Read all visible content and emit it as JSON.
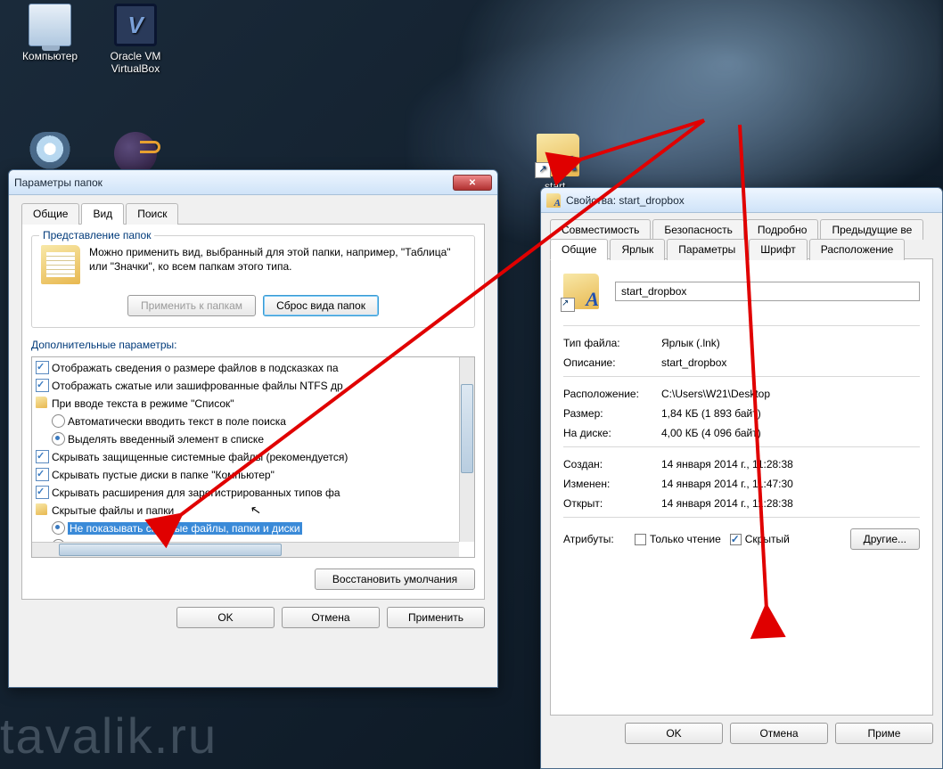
{
  "watermark": "tavalik.ru",
  "desktop": {
    "computer": "Компьютер",
    "vbox": "Oracle VM VirtualBox",
    "shortcut": "start_"
  },
  "folderOptions": {
    "title": "Параметры папок",
    "tabs": {
      "general": "Общие",
      "view": "Вид",
      "search": "Поиск"
    },
    "group_legend": "Представление папок",
    "group_text": "Можно применить вид, выбранный для этой папки, например, \"Таблица\" или \"Значки\", ко всем папкам этого типа.",
    "apply_folders": "Применить к папкам",
    "reset_folders": "Сброс вида папок",
    "adv_label": "Дополнительные параметры:",
    "items": {
      "i1": "Отображать сведения о размере файлов в подсказках па",
      "i2": "Отображать сжатые или зашифрованные файлы NTFS др",
      "i3": "При вводе текста в режиме \"Список\"",
      "i3a": "Автоматически вводить текст в поле поиска",
      "i3b": "Выделять введенный элемент в списке",
      "i4": "Скрывать защищенные системные файлы (рекомендуется)",
      "i5": "Скрывать пустые диски в папке \"Компьютер\"",
      "i6": "Скрывать расширения для зарегистрированных типов фа",
      "i7": "Скрытые файлы и папки",
      "i7a": "Не показывать скрытые файлы, папки и диски",
      "i7b": "Показывать скрытые файлы, папки и диски"
    },
    "restore": "Восстановить умолчания",
    "ok": "OK",
    "cancel": "Отмена",
    "apply": "Применить"
  },
  "props": {
    "title": "Свойства: start_dropbox",
    "tabs": {
      "compat": "Совместимость",
      "security": "Безопасность",
      "details": "Подробно",
      "prev": "Предыдущие ве",
      "general": "Общие",
      "shortcut": "Ярлык",
      "options": "Параметры",
      "font": "Шрифт",
      "layout": "Расположение"
    },
    "name_value": "start_dropbox",
    "type_k": "Тип файла:",
    "type_v": "Ярлык (.lnk)",
    "desc_k": "Описание:",
    "desc_v": "start_dropbox",
    "loc_k": "Расположение:",
    "loc_v": "C:\\Users\\W21\\Desktop",
    "size_k": "Размер:",
    "size_v": "1,84 КБ (1 893 байт)",
    "ondisk_k": "На диске:",
    "ondisk_v": "4,00 КБ (4 096 байт)",
    "created_k": "Создан:",
    "created_v": "14 января 2014 г., 11:28:38",
    "modified_k": "Изменен:",
    "modified_v": "14 января 2014 г., 11:47:30",
    "accessed_k": "Открыт:",
    "accessed_v": "14 января 2014 г., 11:28:38",
    "attr_k": "Атрибуты:",
    "readonly": "Только чтение",
    "hidden": "Скрытый",
    "other": "Другие...",
    "ok": "OK",
    "cancel": "Отмена",
    "apply": "Приме"
  }
}
